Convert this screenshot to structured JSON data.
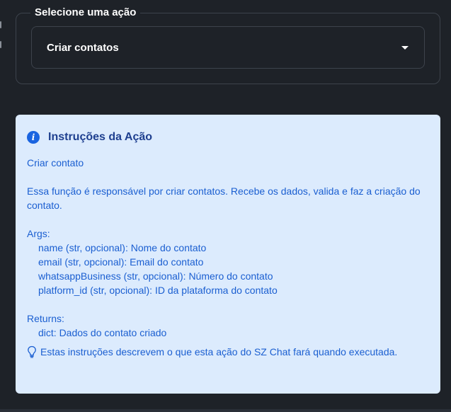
{
  "action_select": {
    "legend": "Selecione uma ação",
    "selected_value": "Criar contatos",
    "caret_icon": "caret-down-icon"
  },
  "instructions": {
    "icon": "info-icon",
    "title": "Instruções da Ação",
    "summary": "Criar contato",
    "description": "Essa função é responsável por criar contatos. Recebe os dados, valida e faz a criação do contato.",
    "args_header": "Args:",
    "args": [
      "name (str, opcional): Nome do contato",
      "email (str, opcional): Email do contato",
      "whatsappBusiness (str, opcional): Número do contato",
      "platform_id (str, opcional): ID da plataforma do contato"
    ],
    "returns_header": "Returns:",
    "returns": [
      "dict: Dados do contato criado"
    ],
    "tip_icon": "lightbulb-icon",
    "tip": "Estas instruções descrevem o que esta ação do SZ Chat fará quando executada."
  },
  "colors": {
    "background": "#1e2228",
    "card_background": "#dcebfd",
    "card_text": "#1b5fd1",
    "card_title": "#1e3f8f",
    "info_icon": "#1a64e0"
  }
}
